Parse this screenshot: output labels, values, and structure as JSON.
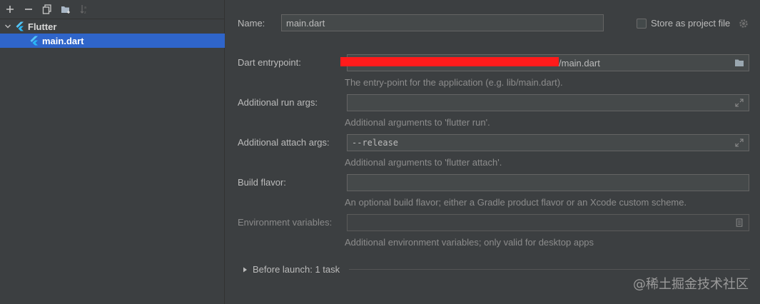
{
  "tree": {
    "group_label": "Flutter",
    "item_label": "main.dart"
  },
  "form": {
    "name_label": "Name:",
    "name_value": "main.dart",
    "store_label": "Store as project file",
    "entry_label": "Dart entrypoint:",
    "entry_value": "/main.dart",
    "entry_hint": "The entry-point for the application (e.g. lib/main.dart).",
    "run_args_label": "Additional run args:",
    "run_args_value": "",
    "run_args_hint": "Additional arguments to 'flutter run'.",
    "attach_label": "Additional attach args:",
    "attach_value": "--release",
    "attach_hint": "Additional arguments to 'flutter attach'.",
    "flavor_label": "Build flavor:",
    "flavor_value": "",
    "flavor_hint": "An optional build flavor; either a Gradle product flavor or an Xcode custom scheme.",
    "env_label": "Environment variables:",
    "env_value": "",
    "env_hint": "Additional environment variables; only valid for desktop apps",
    "before_launch": "Before launch: 1 task"
  },
  "watermark": "@稀土掘金技术社区",
  "colors": {
    "selection": "#2f65ca",
    "background": "#3c3f41",
    "field": "#45494a",
    "redaction": "#ff1b1b",
    "flutter": "#54c5f8"
  }
}
